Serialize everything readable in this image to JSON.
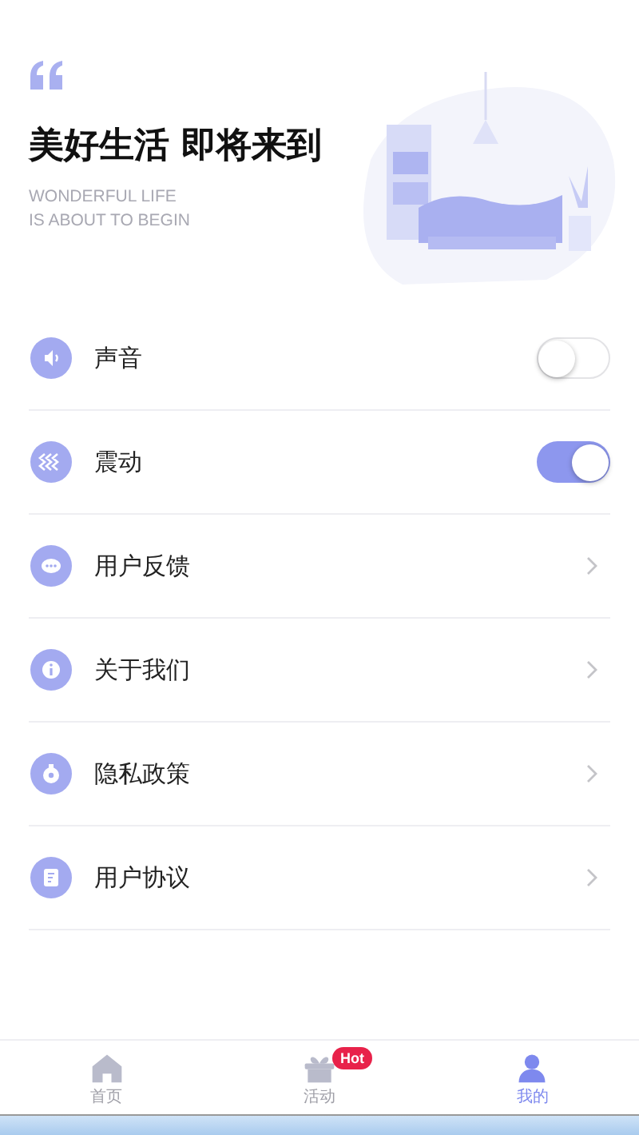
{
  "header": {
    "title": "美好生活 即将来到",
    "subtitle": [
      "WONDERFUL LIFE",
      "IS ABOUT TO BEGIN"
    ],
    "illustration": {
      "kind": "picture"
    }
  },
  "settings": [
    {
      "kind": "toggle",
      "label": "声音",
      "on": false
    },
    {
      "kind": "toggle",
      "label": "震动",
      "on": true
    },
    {
      "kind": "link",
      "label": "用户反馈"
    },
    {
      "kind": "link",
      "label": "关于我们"
    },
    {
      "kind": "link",
      "label": "隐私政策"
    },
    {
      "kind": "link",
      "label": "用户协议"
    }
  ],
  "tab_bar": [
    {
      "label": "首页",
      "selected": false
    },
    {
      "label": "活动",
      "selected": false,
      "badge": "Hot"
    },
    {
      "label": "我的",
      "selected": true
    }
  ]
}
